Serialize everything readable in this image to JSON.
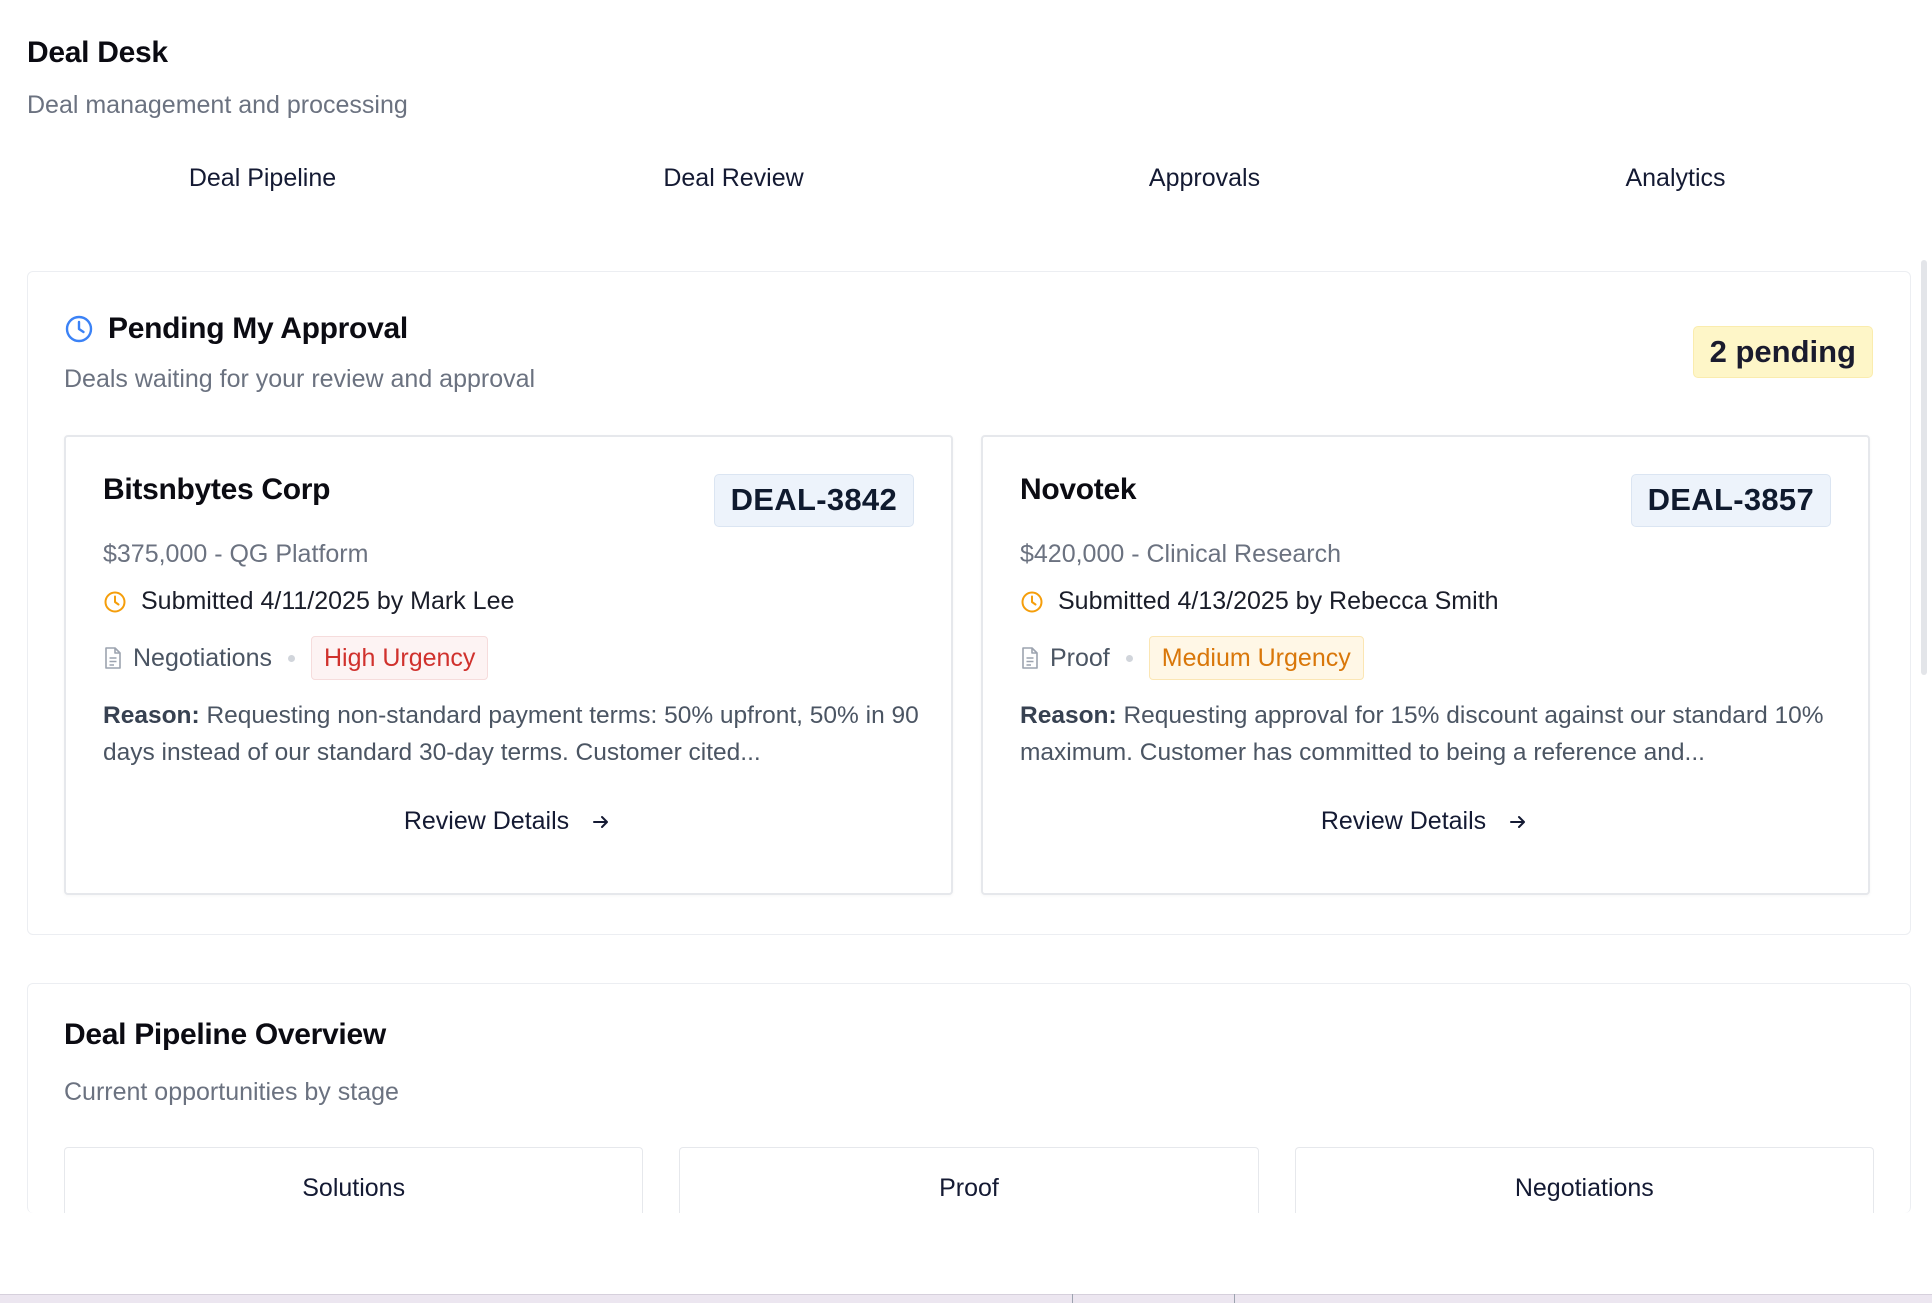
{
  "header": {
    "title": "Deal Desk",
    "subtitle": "Deal management and processing"
  },
  "tabs": [
    {
      "label": "Deal Pipeline"
    },
    {
      "label": "Deal Review"
    },
    {
      "label": "Approvals"
    },
    {
      "label": "Analytics"
    }
  ],
  "approvals": {
    "title": "Pending My Approval",
    "description": "Deals waiting for your review and approval",
    "pending_badge": "2 pending",
    "icon": "clock-icon",
    "accent_color": "#3b82f6",
    "deals": [
      {
        "company": "Bitsnbytes Corp",
        "deal_id": "DEAL-3842",
        "amount_line": "$375,000 - QG Platform",
        "submitted": "Submitted 4/11/2025 by Mark Lee",
        "stage": "Negotiations",
        "urgency": "High Urgency",
        "urgency_color": "#d0312d",
        "reason_label": "Reason:",
        "reason": "Requesting non-standard payment terms: 50% upfront, 50% in 90 days instead of our standard 30-day terms. Customer cited...",
        "action": "Review Details"
      },
      {
        "company": "Novotek",
        "deal_id": "DEAL-3857",
        "amount_line": "$420,000 - Clinical Research",
        "submitted": "Submitted 4/13/2025 by Rebecca Smith",
        "stage": "Proof",
        "urgency": "Medium Urgency",
        "urgency_color": "#d9770a",
        "reason_label": "Reason:",
        "reason": "Requesting approval for 15% discount against our standard 10% maximum. Customer has committed to being a reference and...",
        "action": "Review Details"
      }
    ]
  },
  "pipeline": {
    "title": "Deal Pipeline Overview",
    "description": "Current opportunities by stage",
    "stages": [
      {
        "label": "Solutions"
      },
      {
        "label": "Proof"
      },
      {
        "label": "Negotiations"
      }
    ]
  }
}
